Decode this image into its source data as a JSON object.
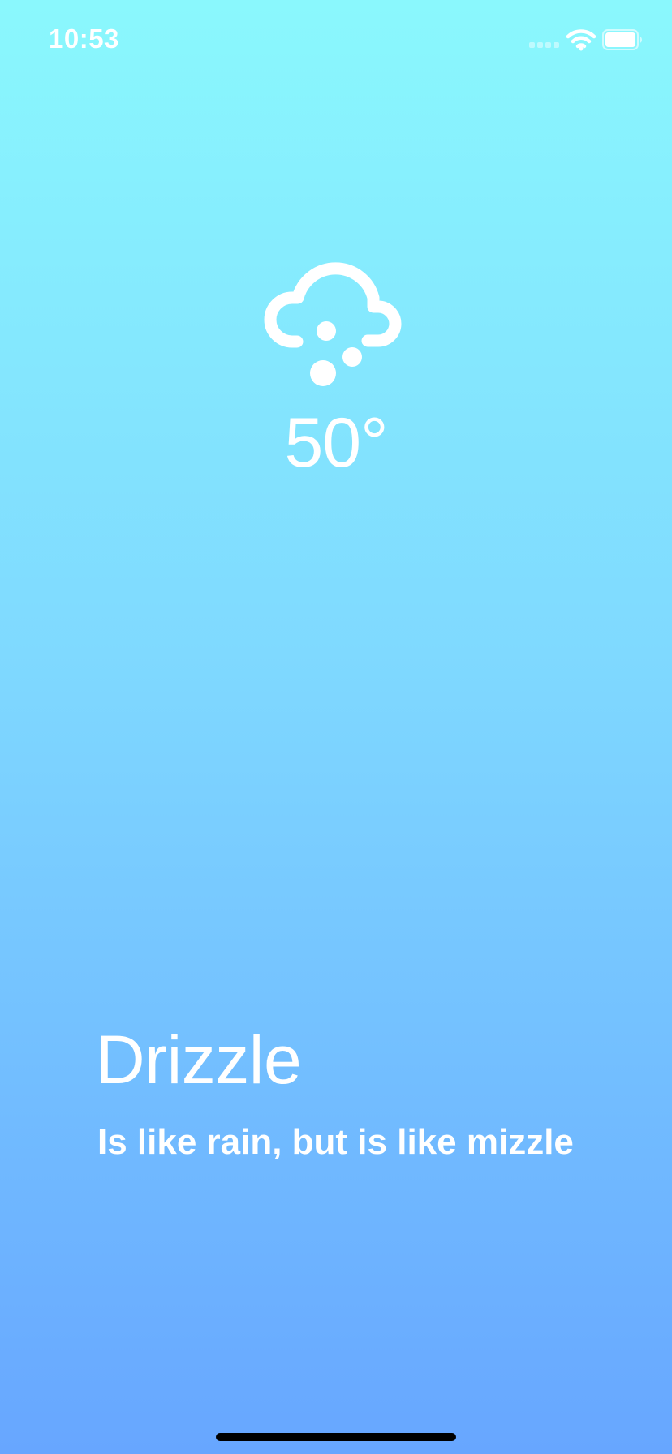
{
  "status_bar": {
    "time": "10:53",
    "icons": [
      "signal-icon",
      "wifi-icon",
      "battery-icon"
    ]
  },
  "weather": {
    "icon": "cloud-drizzle-icon",
    "temperature": "50°"
  },
  "condition": {
    "title": "Drizzle",
    "description": "Is like rain, but is like mizzle"
  },
  "colors": {
    "gradient_top": "#8af8fd",
    "gradient_bottom": "#67a6ff",
    "text": "#ffffff",
    "home_indicator": "#000000"
  }
}
